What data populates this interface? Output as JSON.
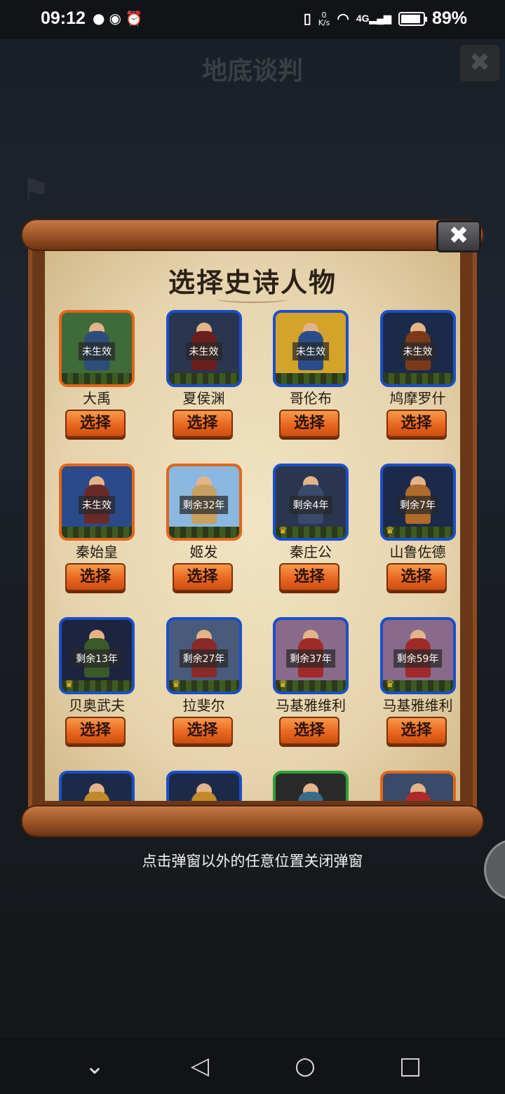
{
  "status": {
    "time": "09:12",
    "left_icons": [
      "wechat-icon",
      "eye-icon",
      "alarm-icon"
    ],
    "net_speed_top": "0",
    "net_speed_bottom": "K/s",
    "signal": "4G",
    "battery_text": "89%",
    "battery_level": 0.89
  },
  "background": {
    "title": "地底谈判",
    "close_glyph": "✖"
  },
  "dialog": {
    "title": "选择史诗人物",
    "close_glyph": "✖",
    "hint": "点击弹窗以外的任意位置关闭弹窗",
    "select_label": "选择",
    "colors": {
      "orange": "#e0661a",
      "blue": "#1b4fc8",
      "green": "#2fa03a"
    },
    "characters": [
      {
        "name": "大禹",
        "badge": "未生效",
        "frame": "orange",
        "crown": false
      },
      {
        "name": "夏侯渊",
        "badge": "未生效",
        "frame": "blue",
        "crown": false
      },
      {
        "name": "哥伦布",
        "badge": "未生效",
        "frame": "blue",
        "crown": false
      },
      {
        "name": "鸠摩罗什",
        "badge": "未生效",
        "frame": "blue",
        "crown": false
      },
      {
        "name": "秦始皇",
        "badge": "未生效",
        "frame": "orange",
        "crown": false
      },
      {
        "name": "姬发",
        "badge": "剩余32年",
        "frame": "orange",
        "crown": false
      },
      {
        "name": "秦庄公",
        "badge": "剩余4年",
        "frame": "blue",
        "crown": true
      },
      {
        "name": "山鲁佐德",
        "badge": "剩余7年",
        "frame": "blue",
        "crown": true
      },
      {
        "name": "贝奥武夫",
        "badge": "剩余13年",
        "frame": "blue",
        "crown": true
      },
      {
        "name": "拉斐尔",
        "badge": "剩余27年",
        "frame": "blue",
        "crown": true
      },
      {
        "name": "马基雅维利",
        "badge": "剩余37年",
        "frame": "blue",
        "crown": true
      },
      {
        "name": "马基雅维利",
        "badge": "剩余59年",
        "frame": "blue",
        "crown": true
      },
      {
        "name": "",
        "badge": "",
        "frame": "blue",
        "crown": false
      },
      {
        "name": "",
        "badge": "",
        "frame": "blue",
        "crown": false
      },
      {
        "name": "",
        "badge": "",
        "frame": "green",
        "crown": false
      },
      {
        "name": "",
        "badge": "",
        "frame": "orange",
        "crown": false
      }
    ]
  },
  "nav": {
    "icons": [
      "chevron-down-icon",
      "back-icon",
      "home-icon",
      "recents-icon"
    ],
    "glyphs": [
      "⌄",
      "◁",
      "○",
      "□"
    ]
  }
}
